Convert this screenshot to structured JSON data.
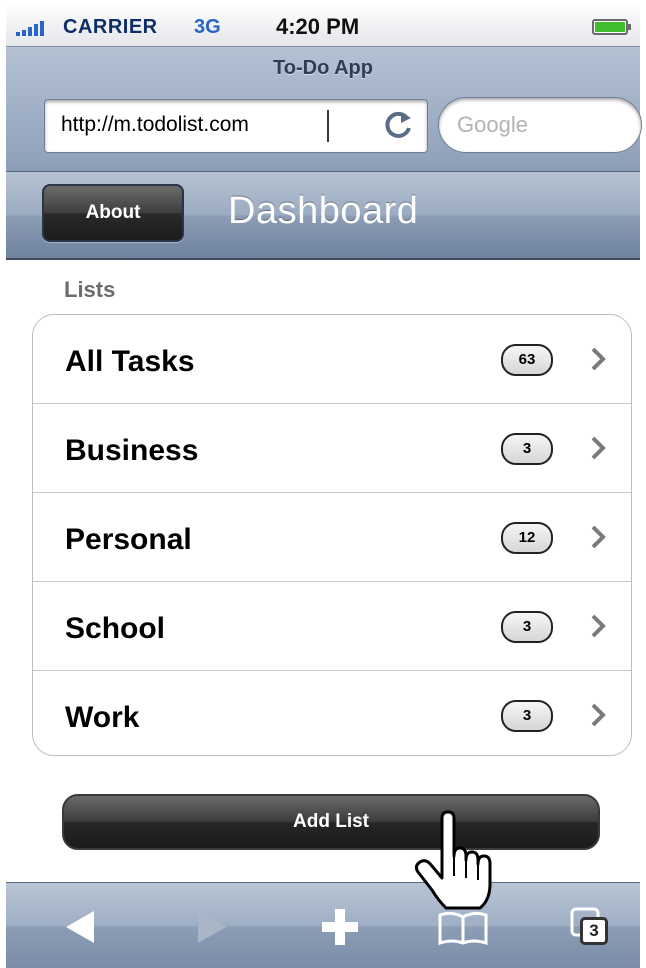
{
  "status_bar": {
    "carrier": "CARRIER",
    "network": "3G",
    "time": "4:20 PM",
    "signal_icon": "signal-bars-icon",
    "battery_icon": "battery-icon"
  },
  "browser": {
    "page_title": "To-Do App",
    "url": "http://m.todolist.com",
    "reload_icon": "reload-icon",
    "search_placeholder": "Google"
  },
  "nav": {
    "about_label": "About",
    "title": "Dashboard"
  },
  "lists_section": {
    "heading": "Lists",
    "items": [
      {
        "label": "All Tasks",
        "count": "63"
      },
      {
        "label": "Business",
        "count": "3"
      },
      {
        "label": "Personal",
        "count": "12"
      },
      {
        "label": "School",
        "count": "3"
      },
      {
        "label": "Work",
        "count": "3"
      }
    ]
  },
  "add_list_label": "Add List",
  "toolbar": {
    "items": [
      "back-icon",
      "forward-icon",
      "add-icon",
      "bookmarks-icon",
      "pages-icon"
    ],
    "pages_count": "3"
  },
  "colors": {
    "nav_gradient_top": "#b7c3d3",
    "nav_gradient_bottom": "#6f83a0",
    "button_dark": "#1c1c1c",
    "carrier_text": "#0f2d66",
    "network_text": "#2b63c9"
  }
}
